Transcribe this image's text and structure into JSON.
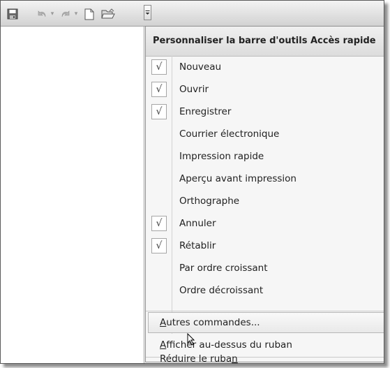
{
  "toolbar": {
    "buttons": [
      {
        "name": "save-icon"
      },
      {
        "name": "undo-icon"
      },
      {
        "name": "redo-icon"
      },
      {
        "name": "new-document-icon"
      },
      {
        "name": "open-folder-icon"
      },
      {
        "name": "customize-dropdown-icon"
      }
    ]
  },
  "menu": {
    "title": "Personnaliser la barre d'outils Accès rapide",
    "items": [
      {
        "label": "Nouveau",
        "checked": true
      },
      {
        "label": "Ouvrir",
        "checked": true
      },
      {
        "label": "Enregistrer",
        "checked": true
      },
      {
        "label": "Courrier électronique",
        "checked": false
      },
      {
        "label": "Impression rapide",
        "checked": false
      },
      {
        "label": "Aperçu avant impression",
        "checked": false
      },
      {
        "label": "Orthographe",
        "checked": false
      },
      {
        "label": "Annuler",
        "checked": true
      },
      {
        "label": "Rétablir",
        "checked": true
      },
      {
        "label": "Par ordre croissant",
        "checked": false
      },
      {
        "label": "Ordre décroissant",
        "checked": false
      }
    ],
    "check_glyph": "√",
    "more_commands": {
      "access": "A",
      "rest": "utres commandes..."
    },
    "show_below": {
      "access": "A",
      "rest": "fficher au-dessus du ruban"
    },
    "minimize": {
      "pre": "Réduire le ruba",
      "access": "n"
    }
  },
  "colors": {
    "menu_bg": "#f6f6f6",
    "toolbar_bg": "#e4e4e4",
    "check": "#3a3a3a"
  }
}
